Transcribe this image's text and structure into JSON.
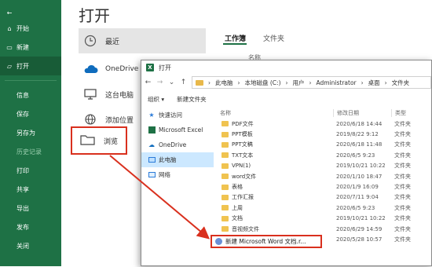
{
  "sidebar": {
    "items": [
      {
        "label": "开始",
        "icon": "home-icon"
      },
      {
        "label": "新建",
        "icon": "new-file-icon"
      },
      {
        "label": "打开",
        "icon": "open-folder-icon"
      }
    ],
    "lower": [
      "信息",
      "保存",
      "另存为",
      "历史记录",
      "打印",
      "共享",
      "导出",
      "发布",
      "关闭"
    ]
  },
  "page_title": "打开",
  "places": [
    {
      "label": "最近",
      "icon": "clock-icon"
    },
    {
      "label": "OneDrive",
      "icon": "cloud-icon"
    },
    {
      "label": "这台电脑",
      "icon": "computer-icon"
    },
    {
      "label": "添加位置",
      "icon": "globe-icon"
    }
  ],
  "browse": {
    "label": "浏览",
    "icon": "folder-icon"
  },
  "right_tabs": {
    "tab1": "工作簿",
    "tab2": "文件夹",
    "name_header": "名称"
  },
  "dialog": {
    "title": "打开",
    "app_icon": "X",
    "address": [
      "此电脑",
      "本地磁盘 (C:)",
      "用户",
      "Administrator",
      "桌面",
      "文件夹"
    ],
    "toolbar": {
      "organize": "组织 ▾",
      "new_folder": "新建文件夹"
    },
    "nav": [
      {
        "label": "快速访问",
        "icon": "star-icon"
      },
      {
        "label": "Microsoft Excel",
        "icon": "excel-icon"
      },
      {
        "label": "OneDrive",
        "icon": "cloud-icon"
      },
      {
        "label": "此电脑",
        "icon": "computer-icon"
      },
      {
        "label": "网络",
        "icon": "network-icon"
      }
    ],
    "columns": {
      "name": "名称",
      "date": "修改日期",
      "type": "类型"
    },
    "files": [
      {
        "name": "PDF文件",
        "date": "2020/6/18 14:44",
        "type": "文件夹"
      },
      {
        "name": "PPT模板",
        "date": "2019/8/22 9:12",
        "type": "文件夹"
      },
      {
        "name": "PPT文稿",
        "date": "2020/6/18 11:48",
        "type": "文件夹"
      },
      {
        "name": "TXT文本",
        "date": "2020/6/5 9:23",
        "type": "文件夹"
      },
      {
        "name": "VPN(1)",
        "date": "2019/10/21 10:22",
        "type": "文件夹"
      },
      {
        "name": "word文件",
        "date": "2020/1/10 18:47",
        "type": "文件夹"
      },
      {
        "name": "表格",
        "date": "2020/1/9 16:09",
        "type": "文件夹"
      },
      {
        "name": "工作汇报",
        "date": "2020/7/11 9:04",
        "type": "文件夹"
      },
      {
        "name": "上周",
        "date": "2020/6/5 9:23",
        "type": "文件夹"
      },
      {
        "name": "文档",
        "date": "2019/10/21 10:22",
        "type": "文件夹"
      },
      {
        "name": "音视频文件",
        "date": "2020/6/29 14:59",
        "type": "文件夹"
      },
      {
        "name": "绩效",
        "date": "2020/5/28 10:57",
        "type": "文件夹"
      }
    ],
    "new_file": "新建 Microsoft Word 文档.r..."
  },
  "colors": {
    "excel_green": "#1e7145",
    "highlight_red": "#d9301e",
    "folder_yellow": "#f0c350"
  }
}
